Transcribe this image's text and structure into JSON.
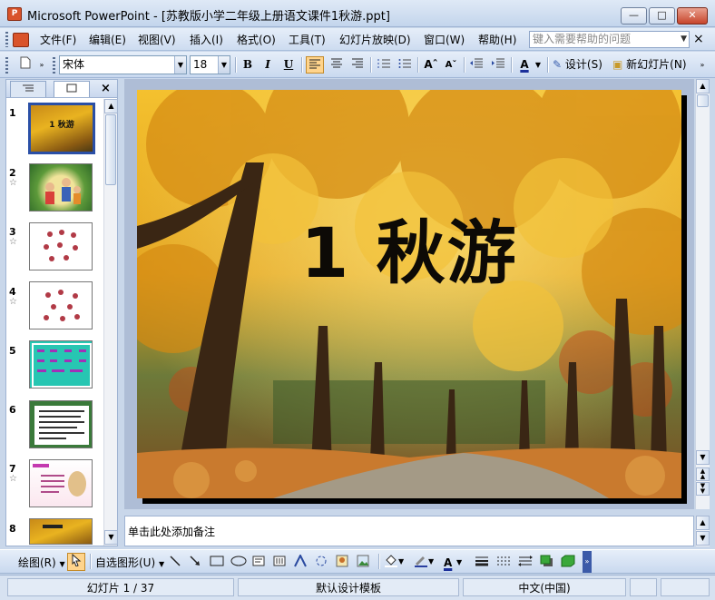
{
  "window": {
    "title": "Microsoft PowerPoint - [苏教版小学二年级上册语文课件1秋游.ppt]",
    "app_icon_label": "P",
    "minimize": "—",
    "maximize": "□",
    "close": "✕"
  },
  "menubar": {
    "items": [
      "文件(F)",
      "编辑(E)",
      "视图(V)",
      "插入(I)",
      "格式(O)",
      "工具(T)",
      "幻灯片放映(D)",
      "窗口(W)",
      "帮助(H)"
    ],
    "help_placeholder": "键入需要帮助的问题",
    "close_doc": "×"
  },
  "toolbar": {
    "font_name": "宋体",
    "font_size": "18",
    "bold": "B",
    "italic": "I",
    "underline": "U",
    "design_label": "设计(S)",
    "new_slide_label": "新幻灯片(N)"
  },
  "left_pane": {
    "tab_outline_icon": "outline-icon",
    "tab_slides_icon": "slides-icon",
    "close": "×",
    "slides": [
      {
        "num": "1",
        "star": false,
        "text": "1  秋游"
      },
      {
        "num": "2",
        "star": true,
        "text": ""
      },
      {
        "num": "3",
        "star": true,
        "text": ""
      },
      {
        "num": "4",
        "star": true,
        "text": ""
      },
      {
        "num": "5",
        "star": false,
        "text": ""
      },
      {
        "num": "6",
        "star": false,
        "text": ""
      },
      {
        "num": "7",
        "star": true,
        "text": ""
      },
      {
        "num": "8",
        "star": false,
        "text": ""
      }
    ]
  },
  "slide": {
    "title": "1  秋游"
  },
  "notes": {
    "placeholder": "单击此处添加备注"
  },
  "drawbar": {
    "draw_label": "绘图(R)",
    "autoshapes_label": "自选图形(U)"
  },
  "status": {
    "slide_info": "幻灯片 1 / 37",
    "template": "默认设计模板",
    "language": "中文(中国)"
  },
  "colors": {
    "accent": "#ffd48c",
    "titlebar": "#dfe9f6",
    "workspace": "#aebdd6"
  }
}
